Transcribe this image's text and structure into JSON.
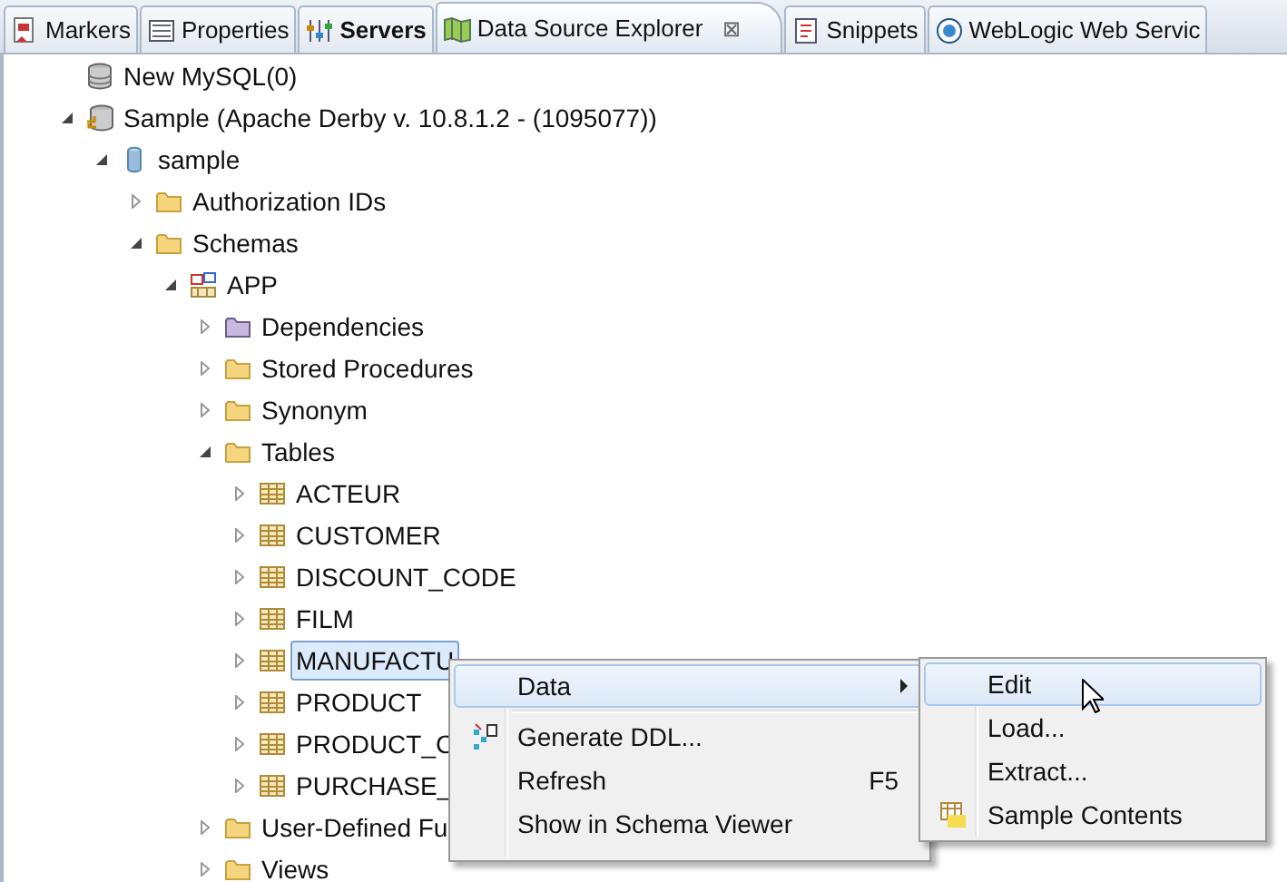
{
  "tabs": [
    {
      "label": "Markers",
      "kind": "markers",
      "selected": false,
      "bold": false
    },
    {
      "label": "Properties",
      "kind": "properties",
      "selected": false,
      "bold": false
    },
    {
      "label": "Servers",
      "kind": "servers",
      "selected": false,
      "bold": true
    },
    {
      "label": "Data Source Explorer",
      "kind": "map",
      "selected": true,
      "bold": false,
      "close": "⊠"
    },
    {
      "label": "Snippets",
      "kind": "snippets",
      "selected": false,
      "bold": false
    },
    {
      "label": "WebLogic Web Servic",
      "kind": "globe",
      "selected": false,
      "bold": false
    }
  ],
  "tree": [
    {
      "label": "New MySQL(0)",
      "kind": "db-server",
      "selected": false
    },
    {
      "label": "Sample (Apache Derby v. 10.8.1.2 - (1095077))",
      "kind": "db-connected",
      "expanded": true,
      "selected": false,
      "children": [
        {
          "label": "sample",
          "kind": "database",
          "expanded": true,
          "selected": false,
          "children": [
            {
              "label": "Authorization IDs",
              "kind": "folder",
              "expanded": false,
              "selected": false
            },
            {
              "label": "Schemas",
              "kind": "folder",
              "expanded": true,
              "selected": false,
              "children": [
                {
                  "label": "APP",
                  "kind": "schema",
                  "expanded": true,
                  "selected": false,
                  "children": [
                    {
                      "label": "Dependencies",
                      "kind": "folder-purple",
                      "expanded": false,
                      "selected": false
                    },
                    {
                      "label": "Stored Procedures",
                      "kind": "folder",
                      "expanded": false,
                      "selected": false
                    },
                    {
                      "label": "Synonym",
                      "kind": "folder",
                      "expanded": false,
                      "selected": false
                    },
                    {
                      "label": "Tables",
                      "kind": "folder",
                      "expanded": true,
                      "selected": false,
                      "children": [
                        {
                          "label": "ACTEUR",
                          "kind": "table",
                          "expanded": false,
                          "selected": false
                        },
                        {
                          "label": "CUSTOMER",
                          "kind": "table",
                          "expanded": false,
                          "selected": false
                        },
                        {
                          "label": "DISCOUNT_CODE",
                          "kind": "table",
                          "expanded": false,
                          "selected": false
                        },
                        {
                          "label": "FILM",
                          "kind": "table",
                          "expanded": false,
                          "selected": false
                        },
                        {
                          "label": "MANUFACTU",
                          "kind": "table",
                          "expanded": false,
                          "selected": true
                        },
                        {
                          "label": "PRODUCT",
                          "kind": "table",
                          "expanded": false,
                          "selected": false
                        },
                        {
                          "label": "PRODUCT_C",
                          "kind": "table",
                          "expanded": false,
                          "selected": false
                        },
                        {
                          "label": "PURCHASE_",
                          "kind": "table",
                          "expanded": false,
                          "selected": false
                        }
                      ]
                    },
                    {
                      "label": "User-Defined Fu",
                      "kind": "folder",
                      "expanded": false,
                      "selected": false
                    },
                    {
                      "label": "Views",
                      "kind": "folder",
                      "expanded": false,
                      "selected": false
                    }
                  ]
                }
              ]
            }
          ]
        }
      ]
    }
  ],
  "context_menu": {
    "items": [
      {
        "kind": "plain",
        "label": "Data",
        "submenu": true,
        "highlighted": true
      },
      {
        "kind": "separator"
      },
      {
        "kind": "ddl",
        "label": "Generate DDL...",
        "highlighted": false
      },
      {
        "kind": "plain",
        "label": "Refresh",
        "shortcut": "F5",
        "highlighted": false
      },
      {
        "kind": "plain",
        "label": "Show in Schema Viewer",
        "highlighted": false
      }
    ]
  },
  "submenu": {
    "items": [
      {
        "kind": "plain",
        "label": "Edit",
        "highlighted": true
      },
      {
        "kind": "plain",
        "label": "Load...",
        "highlighted": false
      },
      {
        "kind": "plain",
        "label": "Extract...",
        "highlighted": false
      },
      {
        "kind": "sample-table",
        "label": "Sample Contents",
        "highlighted": false
      }
    ]
  }
}
